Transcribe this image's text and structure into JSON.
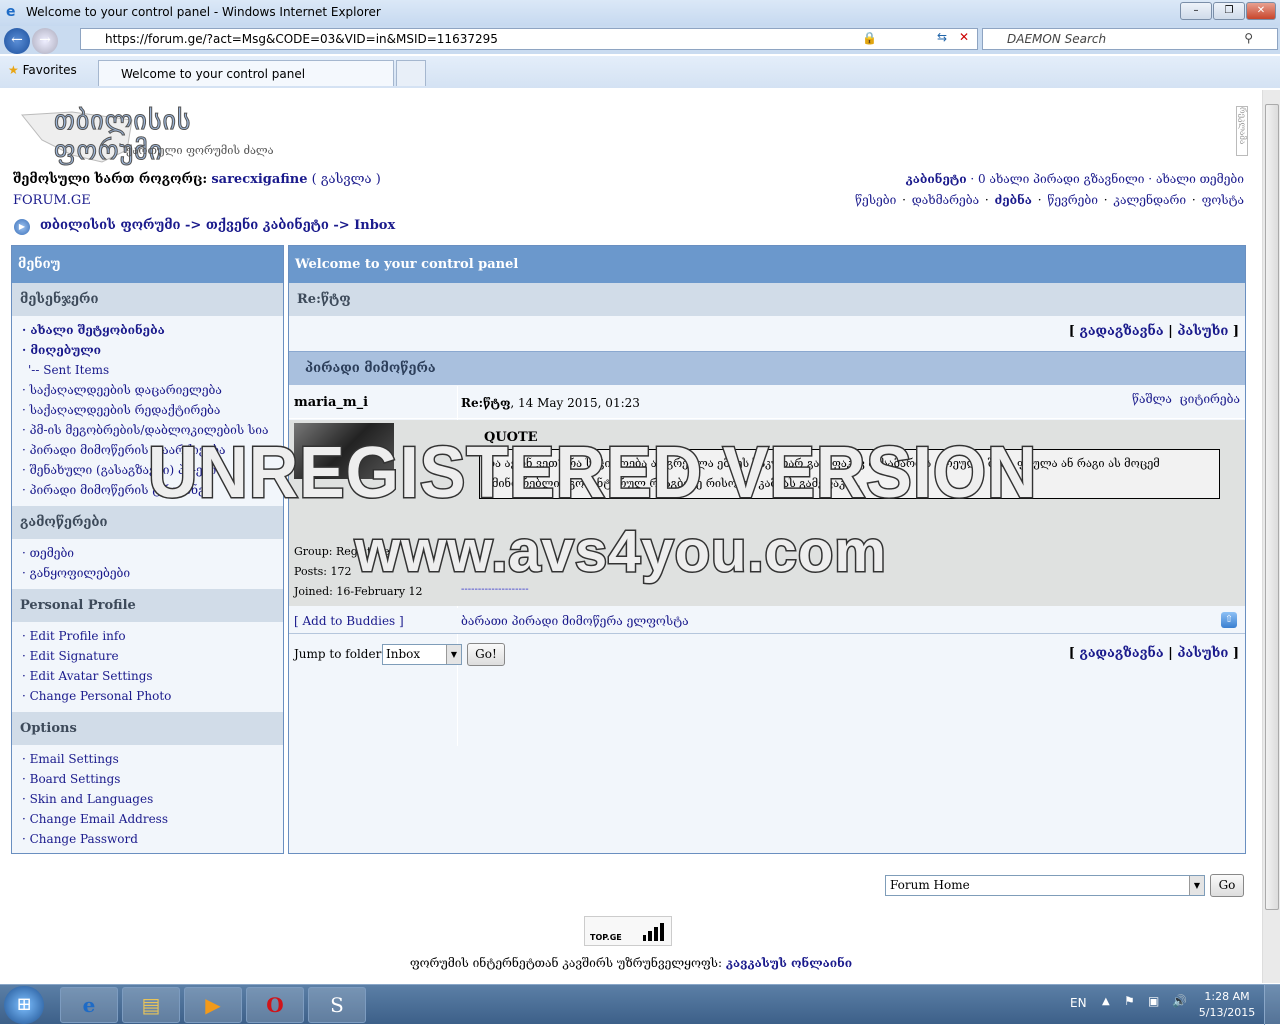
{
  "window": {
    "title": "Welcome to your control panel - Windows Internet Explorer",
    "url": "https://forum.ge/?act=Msg&CODE=03&VID=in&MSID=11637295",
    "search_placeholder": "DAEMON Search",
    "favorites": "Favorites",
    "tab": "Welcome to your control panel"
  },
  "header": {
    "logo_title": "თბილისის ფორუმი",
    "logo_sub": "ქართული ფორუმის ძალა",
    "logged_prefix": "შემოსული ხართ როგორც:",
    "username": "sarecxigafine",
    "logout": "( გასვლა )",
    "site": "FORUM.GE",
    "right_top": {
      "cabinet": "კაბინეტი",
      "new_pm": "· 0 ახალი პირადი გზავნილი ·",
      "new_topics": "ახალი თემები"
    },
    "right_nav": [
      "წესები",
      "დახმარება",
      "ძებნა",
      "წევრები",
      "კალენდარი",
      "ფოსტა"
    ],
    "side_tab": "რეკლამა"
  },
  "breadcrumb": "თბილისის ფორუმი -> თქვენი კაბინეტი -> Inbox",
  "sidebar": {
    "title": "მენიუ",
    "sections": [
      {
        "title": "მესენჯერი",
        "items": [
          "· ახალი შეტყობინება",
          "· მიღებული",
          "'-- Sent Items",
          "· საქაღალდეების დაცარიელება",
          "· საქაღალდეების რედაქტირება",
          "· პმ-ის მეგობრების/დაბლოკილების სია",
          "· პირადი მიმოწერის დაარქივება",
          "· შენახული (გასაგზავნი) პმ-ები",
          "· პირადი მიმოწერის ტრეკინგი"
        ]
      },
      {
        "title": "გამოწერები",
        "items": [
          "· თემები",
          "· განყოფილებები"
        ]
      },
      {
        "title": "Personal Profile",
        "items": [
          "· Edit Profile info",
          "· Edit Signature",
          "· Edit Avatar Settings",
          "· Change Personal Photo"
        ]
      },
      {
        "title": "Options",
        "items": [
          "· Email Settings",
          "· Board Settings",
          "· Skin and Languages",
          "· Change Email Address",
          "· Change Password"
        ]
      }
    ]
  },
  "main": {
    "title": "Welcome to your control panel",
    "subject": "Re:წტფ",
    "actions": {
      "open": "[",
      "forward": "გადაგზავნა",
      "sep": "|",
      "reply": "პასუხი",
      "close": "]"
    },
    "pm_header": "პირადი მიმოწერა",
    "post": {
      "author": "maria_m_i",
      "subject": "Re:წტფ",
      "date": ", 14 May 2015, 01:23",
      "delete": "წაშლა",
      "quote_btn": "ციტირება",
      "quote_label": "QUOTE",
      "quote_text": "რა აქონ ვეთ? რა საჭიროება აქ გრეულა ემმეს საკუთარ გამეფაკავ მისამართს ფრეულა შენს ფეულა ან რაგი ას მოცემ ამინორებლივ კომენტარულ რეაგბისე რისოლმ კამიას გამეფაკავ.",
      "signature": "--------------------",
      "group": "Group: Registered",
      "posts": "Posts: 172",
      "joined": "Joined: 16-February 12",
      "add_buddy": "[ Add to Buddies ]",
      "footer_links": "ბარათი პირადი მიმოწერა ელფოსტა"
    },
    "jump_label": "Jump to folder:",
    "jump_value": "Inbox",
    "go": "Go!"
  },
  "footer": {
    "forum_select": "Forum Home",
    "go": "Go",
    "topge": "TOP.GE",
    "provider_text": "ფორუმის ინტერნეტთან კავშირს უზრუნველყოფს:",
    "provider": "კავკასუს ონლაინი"
  },
  "watermark": {
    "line1": "UNREGISTERED VERSION",
    "line2": "www.avs4you.com"
  },
  "taskbar": {
    "lang": "EN",
    "time": "1:28 AM",
    "date": "5/13/2015"
  }
}
